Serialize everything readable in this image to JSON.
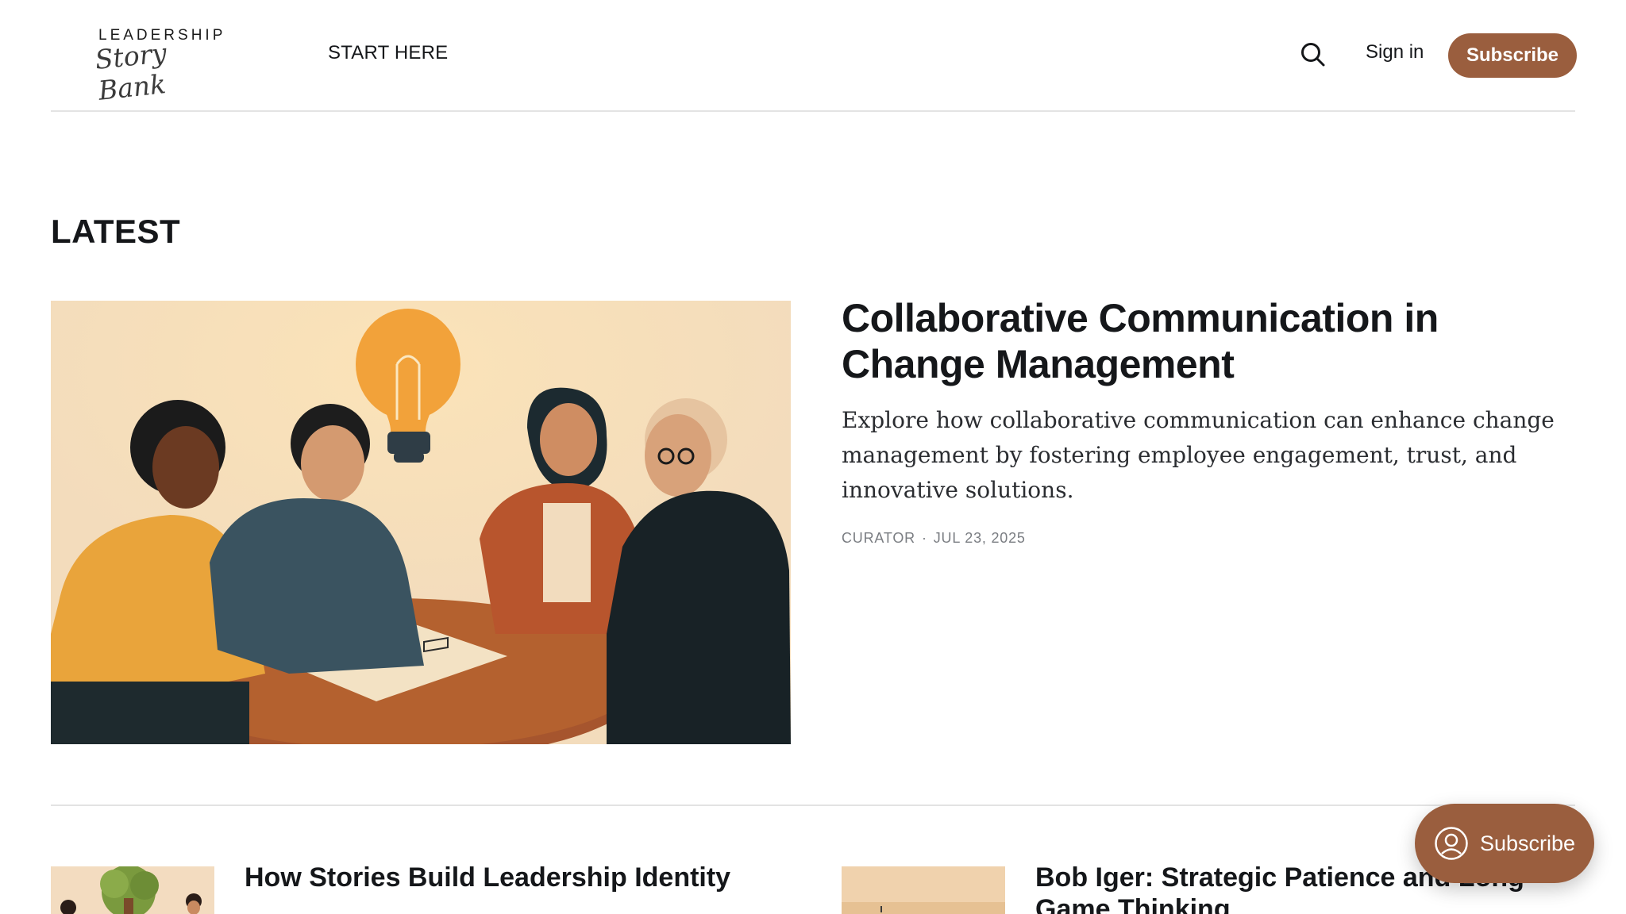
{
  "header": {
    "logo_top": "LEADERSHIP",
    "logo_script": "Story Bank",
    "nav_start": "START HERE",
    "search_icon": "search-icon",
    "signin_label": "Sign in",
    "subscribe_label": "Subscribe"
  },
  "latest": {
    "heading": "LATEST",
    "feature": {
      "title": "Collaborative Communication in Change Management",
      "excerpt": "Explore how collaborative communication can enhance change management by fostering employee engagement, trust, and innovative solutions.",
      "author": "CURATOR",
      "date": "JUL 23, 2025"
    }
  },
  "posts": [
    {
      "title": "How Stories Build Leadership Identity"
    },
    {
      "title": "Bob Iger: Strategic Patience and Long Game Thinking"
    }
  ],
  "floating": {
    "label": "Subscribe",
    "icon": "user-circle-icon"
  },
  "colors": {
    "accent": "#9a5e3e",
    "text": "#15171a",
    "meta": "#7a7d82"
  }
}
